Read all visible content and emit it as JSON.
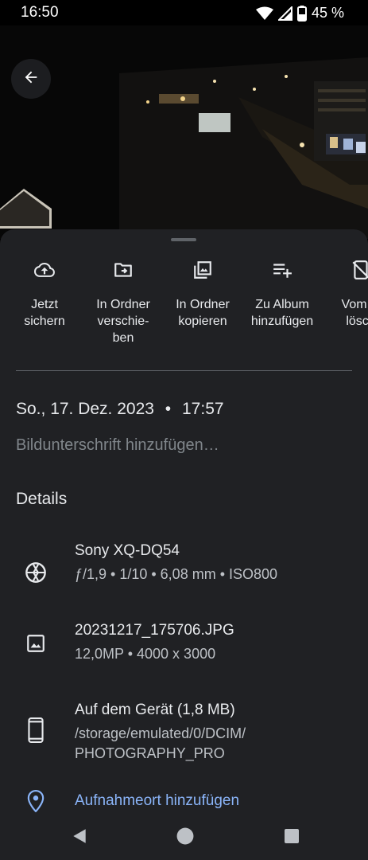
{
  "status_bar": {
    "time": "16:50",
    "battery": "45 %",
    "icons": [
      "wifi-icon",
      "signal-icon",
      "battery-icon"
    ]
  },
  "photo": {
    "back_icon": "arrow-left-icon"
  },
  "actions": [
    {
      "icon": "cloud-upload-icon",
      "label": "Jetzt\nsichern"
    },
    {
      "icon": "folder-move-icon",
      "label": "In Ordner\nverschie-\nben"
    },
    {
      "icon": "copy-to-folder-icon",
      "label": "In Ordner\nkopieren"
    },
    {
      "icon": "playlist-add-icon",
      "label": "Zu Album\nhinzufügen"
    },
    {
      "icon": "phone-erase-icon",
      "label": "Vom G\nlösch"
    }
  ],
  "info": {
    "date": "So., 17. Dez. 2023",
    "separator": "•",
    "time": "17:57",
    "caption_placeholder": "Bildunterschrift hinzufügen…",
    "details_heading": "Details"
  },
  "details": {
    "camera": {
      "icon": "aperture-icon",
      "title": "Sony XQ-DQ54",
      "specs": "ƒ/1,9  •  1/10  •  6,08 mm  •  ISO800"
    },
    "file": {
      "icon": "image-icon",
      "title": "20231217_175706.JPG",
      "specs": "12,0MP  •  4000 x 3000"
    },
    "storage": {
      "icon": "smartphone-icon",
      "title": "Auf dem Gerät (1,8 MB)",
      "path_line1": "/storage/emulated/0/DCIM/",
      "path_line2": "PHOTOGRAPHY_PRO"
    },
    "location": {
      "icon": "location-pin-icon",
      "label": "Aufnahmeort hinzufügen",
      "color": "#8ab4f8"
    }
  },
  "nav_bar": {
    "icons": [
      "back-triangle-icon",
      "home-circle-icon",
      "recents-square-icon"
    ]
  }
}
